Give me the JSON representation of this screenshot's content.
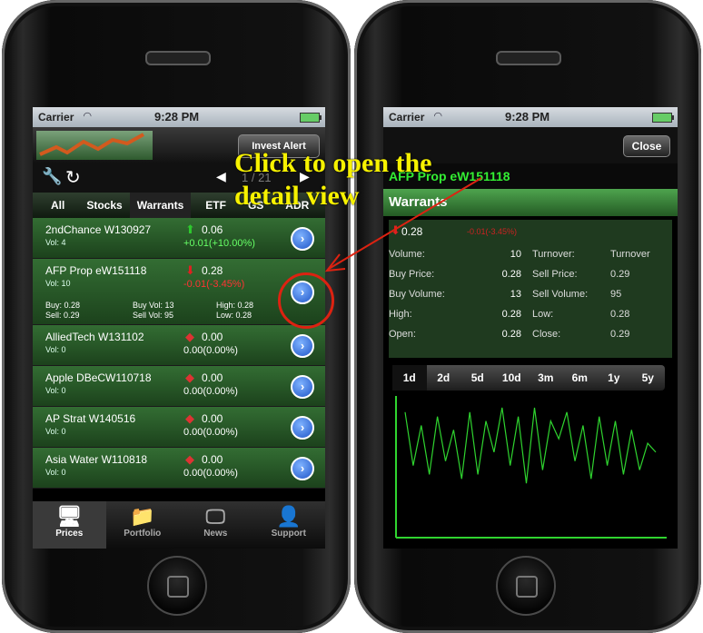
{
  "left": {
    "status": {
      "carrier": "Carrier",
      "time": "9:28 PM"
    },
    "invest_alert": "Invest Alert",
    "pager": {
      "page": "1 / 21"
    },
    "tabs": [
      "All",
      "Stocks",
      "Warrants",
      "ETF",
      "GS",
      "ADR"
    ],
    "rows": [
      {
        "name": "2ndChance W130927",
        "vol": "Vol: 4",
        "price": "0.06",
        "change": "+0.01(+10.00%)",
        "dir": "up"
      },
      {
        "name": "AFP Prop eW151118",
        "vol": "Vol: 10",
        "price": "0.28",
        "change": "-0.01(-3.45%)",
        "dir": "down",
        "details": {
          "buy": "Buy: 0.28",
          "sell": "Sell: 0.29",
          "buy_vol": "Buy Vol: 13",
          "sell_vol": "Sell Vol: 95",
          "high": "High: 0.28",
          "low": "Low: 0.28"
        }
      },
      {
        "name": "AlliedTech W131102",
        "vol": "Vol: 0",
        "price": "0.00",
        "change": "0.00(0.00%)",
        "dir": "flat"
      },
      {
        "name": "Apple DBeCW110718",
        "vol": "Vol: 0",
        "price": "0.00",
        "change": "0.00(0.00%)",
        "dir": "flat"
      },
      {
        "name": "AP Strat W140516",
        "vol": "Vol: 0",
        "price": "0.00",
        "change": "0.00(0.00%)",
        "dir": "flat"
      },
      {
        "name": "Asia Water W110818",
        "vol": "Vol: 0",
        "price": "0.00",
        "change": "0.00(0.00%)",
        "dir": "flat"
      }
    ],
    "tabbar": [
      "Prices",
      "Portfolio",
      "News",
      "Support"
    ]
  },
  "right": {
    "status": {
      "carrier": "Carrier",
      "time": "9:28 PM"
    },
    "close": "Close",
    "title": "AFP Prop eW151118",
    "category": "Warrants",
    "price": "0.28",
    "change": "-0.01(-3.45%)",
    "fields": [
      {
        "label": "Volume:",
        "value": "10",
        "label2": "Turnover:",
        "value2": "Turnover"
      },
      {
        "label": "Buy Price:",
        "value": "0.28",
        "label2": "Sell Price:",
        "value2": "0.29"
      },
      {
        "label": "Buy Volume:",
        "value": "13",
        "label2": "Sell Volume:",
        "value2": "95"
      },
      {
        "label": "High:",
        "value": "0.28",
        "label2": "Low:",
        "value2": "0.28"
      },
      {
        "label": "Open:",
        "value": "0.28",
        "label2": "Close:",
        "value2": "0.29"
      }
    ],
    "ranges": [
      "1d",
      "2d",
      "5d",
      "10d",
      "3m",
      "6m",
      "1y",
      "5y"
    ],
    "chart_data": {
      "type": "line",
      "y": [
        0.9,
        0.3,
        0.75,
        0.2,
        0.85,
        0.35,
        0.7,
        0.15,
        0.9,
        0.2,
        0.8,
        0.45,
        0.95,
        0.3,
        0.85,
        0.1,
        0.95,
        0.25,
        0.8,
        0.6,
        0.9,
        0.35,
        0.75,
        0.15,
        0.85,
        0.3,
        0.8,
        0.2,
        0.7,
        0.25,
        0.55,
        0.45
      ]
    }
  },
  "annotation": {
    "line1": "Click to open the",
    "line2": "detail view"
  },
  "colors": {
    "up": "#2ec82e",
    "down": "#e02020",
    "chart_line": "#2fd42f",
    "annotation_text": "#f7f200",
    "annotation_circle": "#d21"
  }
}
